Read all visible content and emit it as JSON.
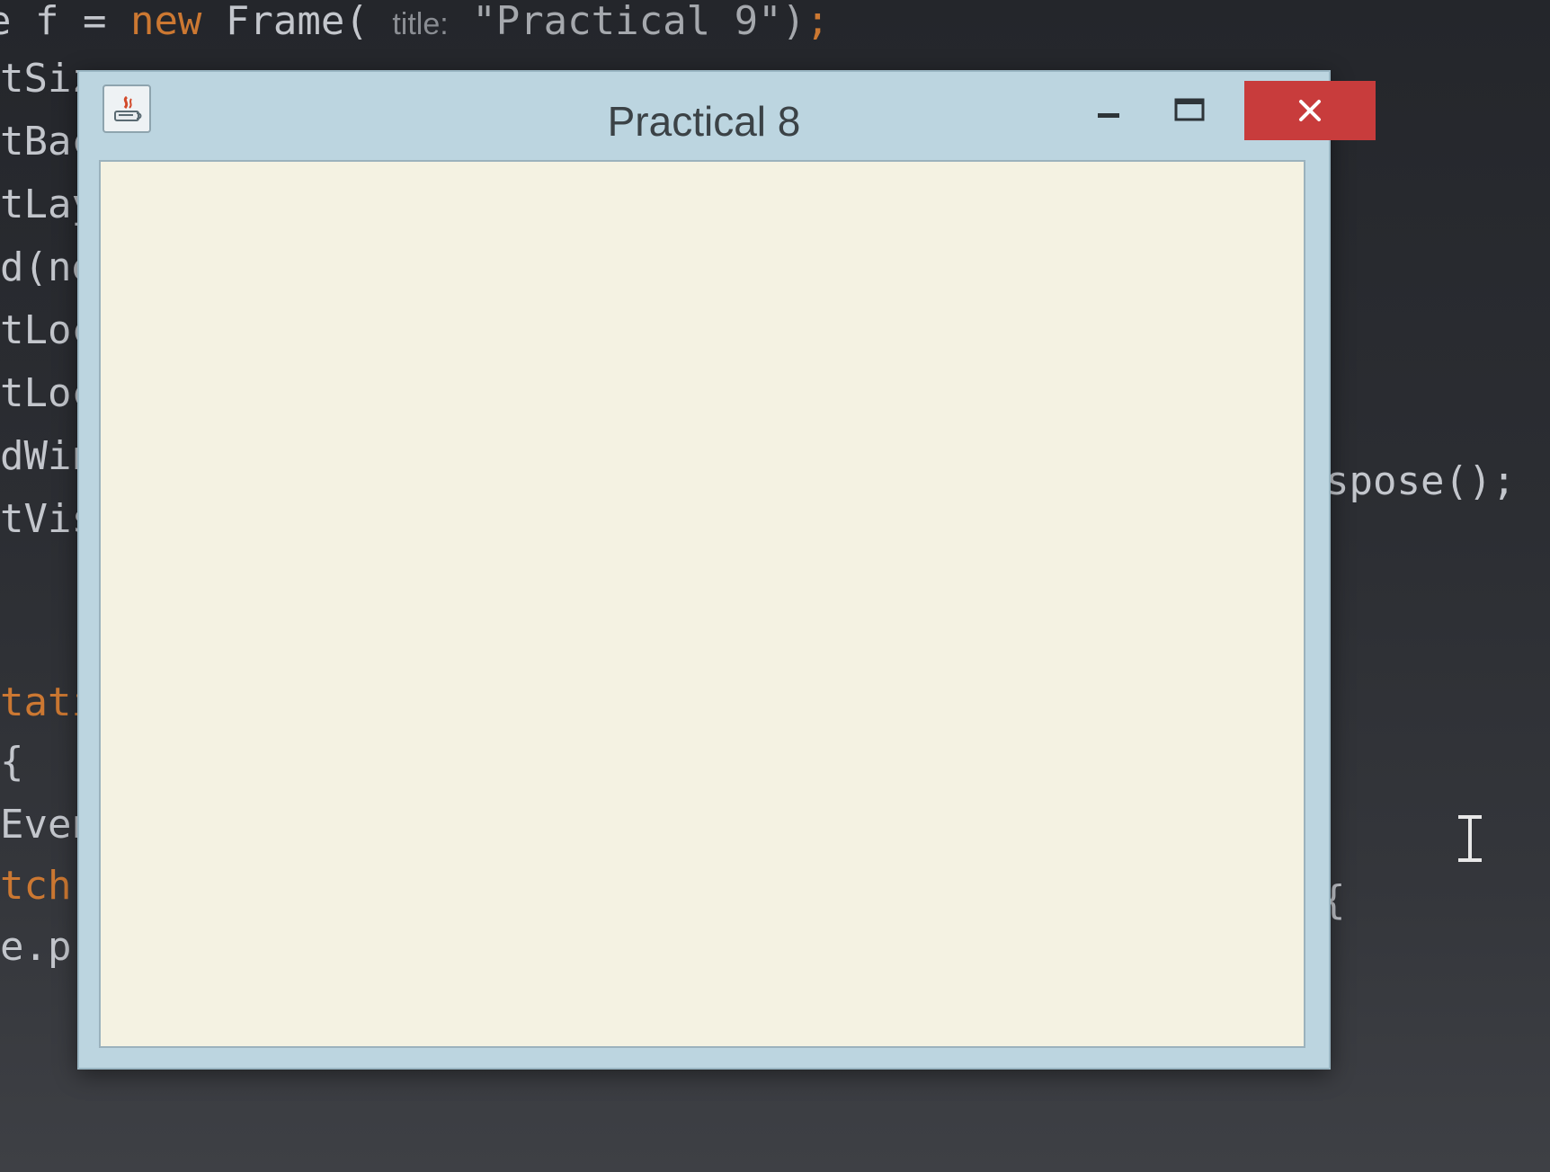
{
  "background_code": {
    "top_line": {
      "prefix": "e f = ",
      "keyword": "new",
      "call": " Frame( ",
      "param_hint": "title:",
      "string": " \"Practical 9\")",
      "semicolon": ";"
    },
    "left_fragments": [
      "tSiz",
      "tBac",
      "tLay",
      "d(ne",
      "tLoc",
      "tLoc",
      "dWin",
      "tVis",
      "tati",
      "{",
      "Even",
      "tch",
      "e.pr"
    ],
    "right_fragments": {
      "dispose": "spose();",
      "brace": "{"
    }
  },
  "window": {
    "title": "Practical 8",
    "app_icon": "java-icon",
    "controls": {
      "minimize": "minimize-icon",
      "maximize": "maximize-icon",
      "close": "close-icon"
    },
    "client_area_color": "#f4f2e2",
    "close_color": "#c83c3c"
  },
  "cursor": "text-cursor-icon"
}
